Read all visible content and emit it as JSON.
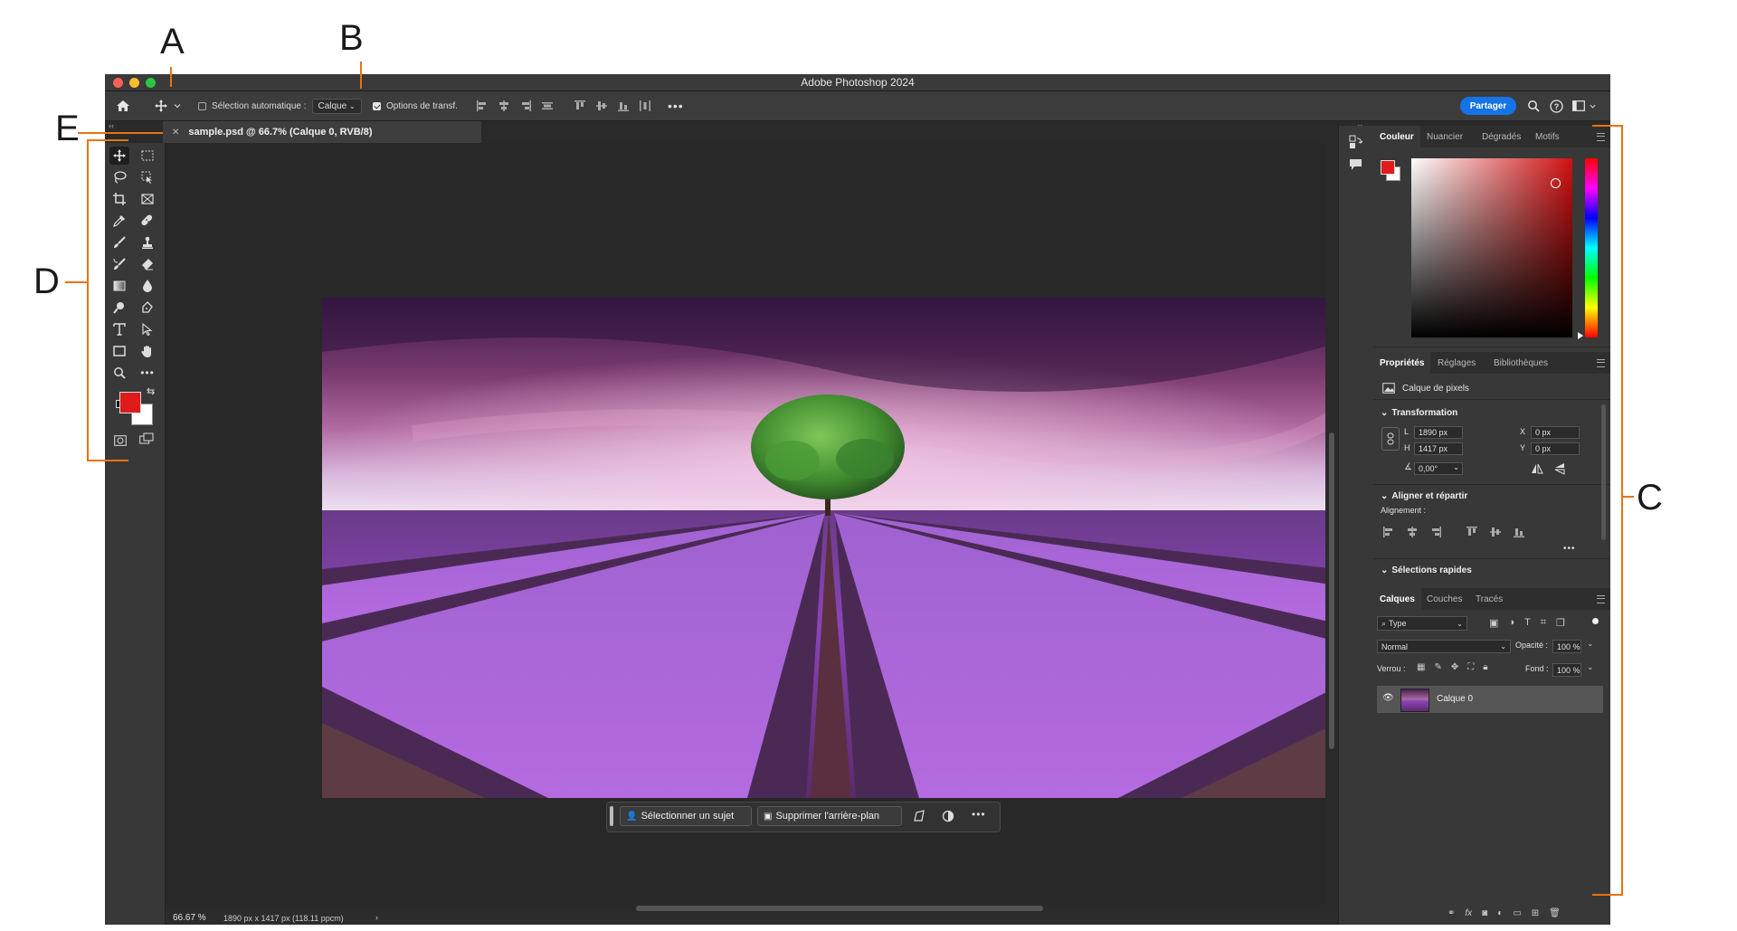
{
  "callouts": {
    "a": "A",
    "b": "B",
    "c": "C",
    "d": "D",
    "e": "E"
  },
  "window": {
    "title": "Adobe Photoshop 2024"
  },
  "options_bar": {
    "auto_select_label": "Sélection automatique :",
    "auto_select_value": "Calque",
    "transform_options_label": "Options de transf.",
    "share_label": "Partager"
  },
  "document_tab": {
    "title": "sample.psd @ 66.7% (Calque 0, RVB/8)"
  },
  "status_bar": {
    "zoom": "66.67 %",
    "doc_info": "1890 px x 1417 px (118.11 ppcm)"
  },
  "contextual_bar": {
    "select_subject": "Sélectionner un sujet",
    "remove_background": "Supprimer l'arrière-plan"
  },
  "color_panel": {
    "tabs": [
      "Couleur",
      "Nuancier",
      "Dégradés",
      "Motifs"
    ],
    "foreground": "#e01b1b",
    "background": "#ffffff"
  },
  "properties_panel": {
    "tabs": [
      "Propriétés",
      "Réglages",
      "Bibliothèques"
    ],
    "layer_kind": "Calque de pixels",
    "transform_header": "Transformation",
    "w_label": "L",
    "w_value": "1890 px",
    "h_label": "H",
    "h_value": "1417 px",
    "x_label": "X",
    "x_value": "0 px",
    "y_label": "Y",
    "y_value": "0 px",
    "angle_value": "0,00°",
    "align_header": "Aligner et répartir",
    "align_label": "Alignement :",
    "quick_sel_header": "Sélections rapides"
  },
  "layers_panel": {
    "tabs": [
      "Calques",
      "Couches",
      "Tracés"
    ],
    "filter_kind": "Type",
    "blend_mode": "Normal",
    "opacity_label": "Opacité :",
    "opacity_value": "100 %",
    "lock_label": "Verrou :",
    "fill_label": "Fond :",
    "fill_value": "100 %",
    "layers": [
      {
        "name": "Calque 0"
      }
    ]
  },
  "colors": {
    "accent": "#1473e6",
    "callout": "#e8730f"
  }
}
